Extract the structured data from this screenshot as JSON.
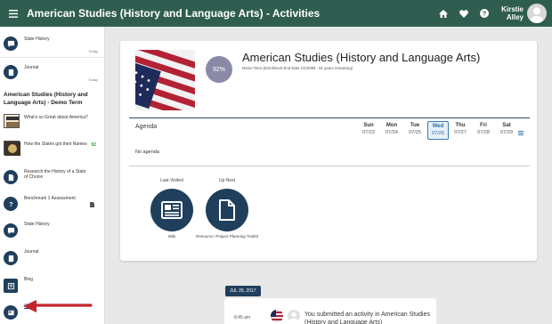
{
  "header": {
    "title": "American Studies (History and Language Arts) - Activities",
    "user_first": "Kirstie",
    "user_last": "Alley",
    "icons": [
      "home-icon",
      "heart-icon",
      "help-icon"
    ]
  },
  "sidebar": {
    "top_items": [
      {
        "label": "State History",
        "meta": "Today",
        "icon": "chat-icon"
      },
      {
        "label": "Journal",
        "meta": "Today",
        "icon": "journal-icon"
      }
    ],
    "course_title": "American Studies (History and Language Arts) - Demo Term",
    "items": [
      {
        "label": "What's so Great about America?",
        "icon": "thumbnail"
      },
      {
        "label": "How the States got their Names",
        "score": "92",
        "icon": "thumbnail"
      },
      {
        "label": "Research the History of a State of Choice",
        "icon": "document-icon"
      },
      {
        "label": "Benchmark 1 Assessment",
        "icon": "question-icon"
      },
      {
        "label": "State History",
        "icon": "chat-icon"
      },
      {
        "label": "Journal",
        "icon": "journal-icon"
      },
      {
        "label": "Blog",
        "icon": "blog-icon"
      },
      {
        "label": "Wiki",
        "icon": "wiki-icon"
      }
    ]
  },
  "course": {
    "title": "American Studies (History and Language Arts)",
    "subtitle": "Demo Term (Enrollment End Date 1/2/2099 - 81 years remaining)",
    "grade": "92%"
  },
  "agenda": {
    "label": "Agenda",
    "empty_text": "No agenda",
    "days": [
      {
        "name": "Sun",
        "date": "07/23"
      },
      {
        "name": "Mon",
        "date": "07/24"
      },
      {
        "name": "Tue",
        "date": "07/25"
      },
      {
        "name": "Wed",
        "date": "07/26",
        "selected": true
      },
      {
        "name": "Thu",
        "date": "07/27"
      },
      {
        "name": "Fri",
        "date": "07/28"
      },
      {
        "name": "Sat",
        "date": "07/29"
      }
    ]
  },
  "last_visited": {
    "heading": "Last Visited",
    "label": "Wiki"
  },
  "up_next": {
    "heading": "Up Next",
    "label": "Resource: Project Planning Toolkit"
  },
  "feed": {
    "date": "JUL 26, 2017",
    "time": "8:45 am",
    "text": "You submitted an activity in American Studies (History and Language Arts)"
  },
  "colors": {
    "header": "#2f5e50",
    "navy": "#1f3f5c",
    "accent": "#3a7ab0",
    "arrow": "#c0262c"
  }
}
